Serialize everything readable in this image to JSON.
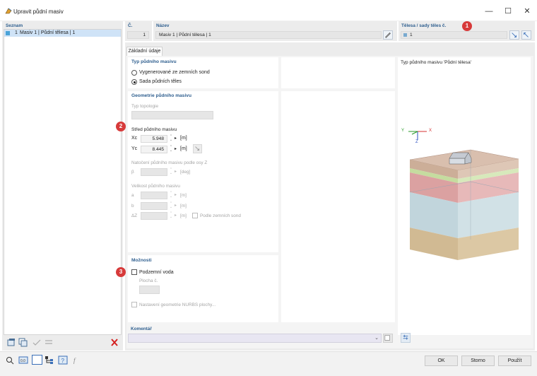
{
  "window": {
    "title": "Upravit půdní masiv"
  },
  "window_controls": {
    "minimize": "—",
    "maximize": "☐",
    "close": "✕"
  },
  "list_panel": {
    "header": "Seznam",
    "items": [
      {
        "number": "1",
        "label": "Masiv 1 | Půdní tělesa | 1"
      }
    ]
  },
  "top_fields": {
    "number_label": "Č.",
    "number_value": "1",
    "name_label": "Název",
    "name_value": "Masiv 1 | Půdní tělesa | 1",
    "solids_label": "Tělesa / sady těles č.",
    "solids_value": "1"
  },
  "tabs": [
    {
      "label": "Základní údaje"
    }
  ],
  "soil_type": {
    "header": "Typ půdního masivu",
    "options": [
      {
        "label": "Vygenerované ze zemních sond",
        "selected": false
      },
      {
        "label": "Sada půdních těles",
        "selected": true
      }
    ]
  },
  "geometry": {
    "header": "Geometrie půdního masivu",
    "topology_label": "Typ topologie",
    "center_label": "Střed půdního masivu",
    "xc_label": "Xc",
    "xc_value": "5.948",
    "yc_label": "Yc",
    "yc_value": "8.445",
    "unit_m": "[m]",
    "rotation_label": "Natočení půdního masivu podle osy Z",
    "beta_label": "β",
    "unit_deg": "[deg]",
    "size_label": "Velikost půdního masivu",
    "a_label": "a",
    "b_label": "b",
    "dz_label": "ΔZ",
    "by_probes_label": "Podle zemních sond"
  },
  "options": {
    "header": "Možnosti",
    "groundwater_label": "Podzemní voda",
    "surface_label": "Plocha č.",
    "nurbs_label": "Nastavení geometrie NURBS plochy..."
  },
  "comment": {
    "label": "Komentář"
  },
  "preview": {
    "title": "Typ půdního masivu 'Půdní tělesa'",
    "axis_y": "Y",
    "axis_x": "X",
    "axis_z": "Z",
    "colors": {
      "top_layer": "#d4b8a4",
      "green_layer": "#cfe3b0",
      "red_layer": "#dba6a6",
      "blue_layer": "#c4d7dd",
      "bottom_layer": "#d6c09a"
    }
  },
  "badges": {
    "one": "1",
    "two": "2",
    "three": "3"
  },
  "footer": {
    "ok": "OK",
    "cancel": "Storno",
    "apply": "Použít"
  }
}
